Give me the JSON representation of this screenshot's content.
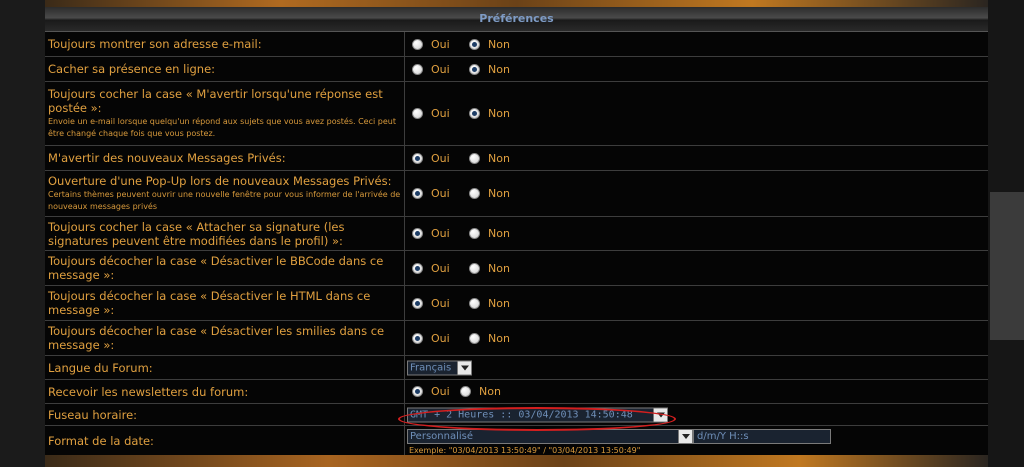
{
  "section_title": "Préférences",
  "rows": [
    {
      "label": "Toujours montrer son adresse e-mail:",
      "yes": "Oui",
      "no": "Non",
      "selected": "no"
    },
    {
      "label": "Cacher sa présence en ligne:",
      "yes": "Oui",
      "no": "Non",
      "selected": "no"
    },
    {
      "label": "Toujours cocher la case « M'avertir lorsqu'une réponse est postée »:",
      "sub": "Envoie un e-mail lorsque quelqu'un répond aux sujets que vous avez postés. Ceci peut être changé chaque fois que vous postez.",
      "yes": "Oui",
      "no": "Non",
      "selected": "no"
    },
    {
      "label": "M'avertir des nouveaux Messages Privés:",
      "yes": "Oui",
      "no": "Non",
      "selected": "yes"
    },
    {
      "label": "Ouverture d'une Pop-Up lors de nouveaux Messages Privés:",
      "sub": "Certains thèmes peuvent ouvrir une nouvelle fenêtre pour vous informer de l'arrivée de nouveaux messages privés",
      "yes": "Oui",
      "no": "Non",
      "selected": "yes"
    },
    {
      "label": "Toujours cocher la case « Attacher sa signature (les signatures peuvent être modifiées dans le profil) »:",
      "yes": "Oui",
      "no": "Non",
      "selected": "yes"
    },
    {
      "label": "Toujours décocher la case « Désactiver le BBCode dans ce message »:",
      "yes": "Oui",
      "no": "Non",
      "selected": "yes"
    },
    {
      "label": "Toujours décocher la case « Désactiver le HTML dans ce message »:",
      "yes": "Oui",
      "no": "Non",
      "selected": "yes"
    },
    {
      "label": "Toujours décocher la case « Désactiver les smilies dans ce message »:",
      "yes": "Oui",
      "no": "Non",
      "selected": "yes"
    }
  ],
  "language": {
    "label": "Langue du Forum:",
    "value": "Français"
  },
  "newsletter": {
    "label": "Recevoir les newsletters du forum:",
    "yes": "Oui",
    "no": "Non",
    "selected": "yes"
  },
  "timezone": {
    "label": "Fuseau horaire:",
    "value": "GMT + 2 Heures    :: 03/04/2013 14:50:48"
  },
  "date_format": {
    "label": "Format de la date:",
    "select_value": "Personnalisé",
    "custom_value": "d/m/Y H::s",
    "example": "Exemple: \"03/04/2013 13:50:49\" / \"03/04/2013 13:50:49\""
  },
  "colors": {
    "accent_text": "#e0a040",
    "title_blue": "#7e9cc6",
    "highlight": "#d41f1f"
  }
}
